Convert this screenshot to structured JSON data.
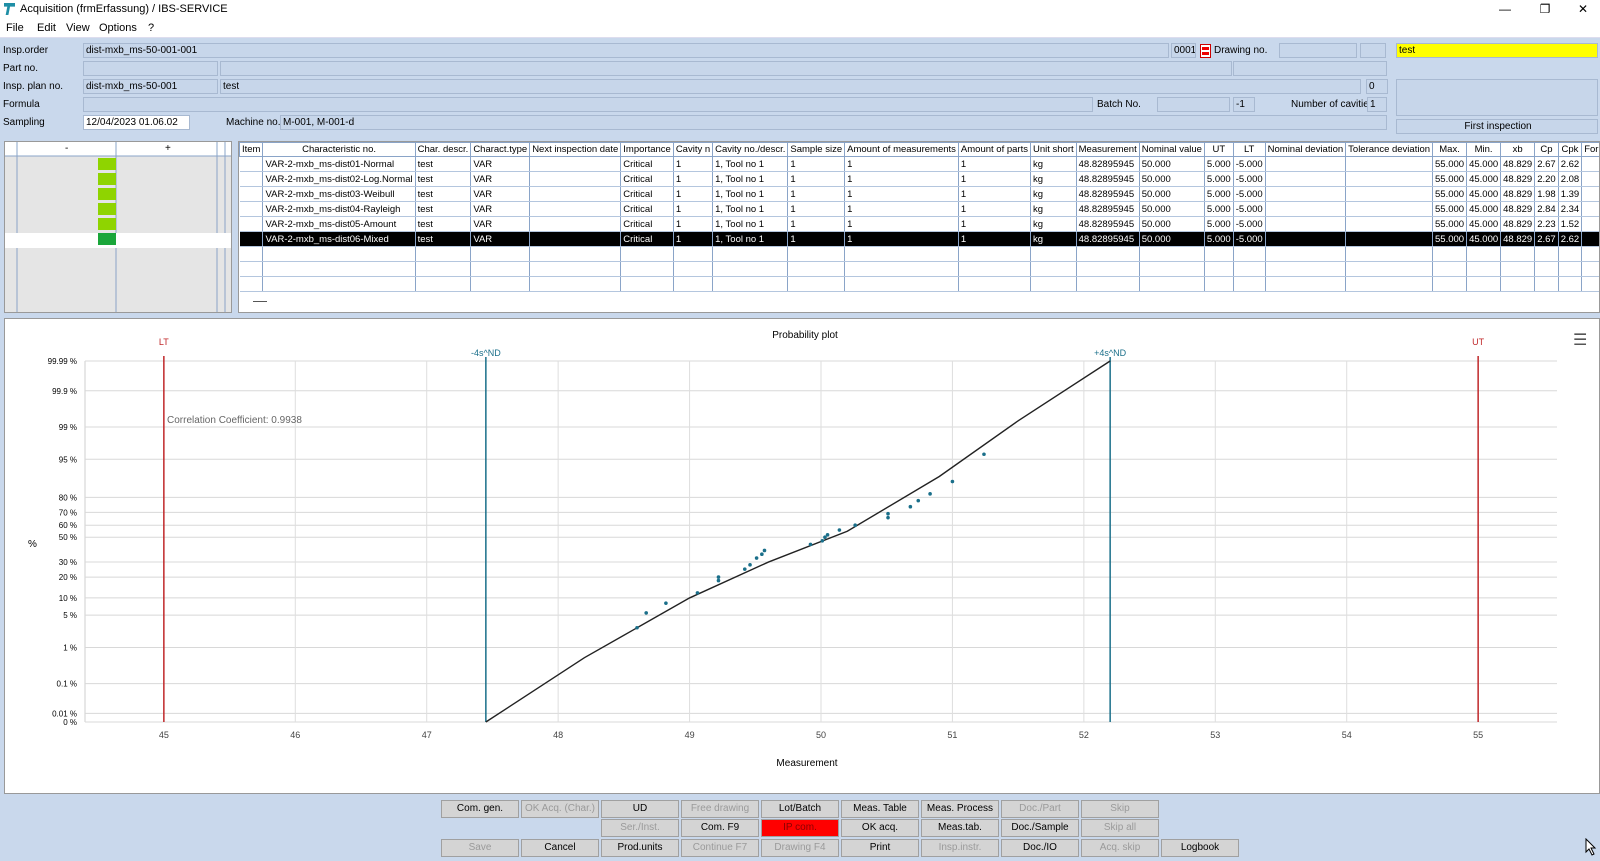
{
  "window": {
    "title": "Acquisition (frmErfassung) / IBS-SERVICE",
    "min": "—",
    "max": "❐",
    "close": "✕"
  },
  "menu": [
    "File",
    "Edit",
    "View",
    "Options",
    "?"
  ],
  "header": {
    "insp_order_label": "Insp.order",
    "insp_order_value": "dist-mxb_ms-50-001-001",
    "insp_order_num": "0001",
    "drawing_label": "Drawing no.",
    "yellow_value": "test",
    "part_label": "Part no.",
    "plan_label": "Insp. plan no.",
    "plan_value": "dist-mxb_ms-50-001",
    "plan_desc": "test",
    "plan_num": "0",
    "formula_label": "Formula",
    "batch_label": "Batch No.",
    "batch_num": "-1",
    "cavities_label": "Number of cavities",
    "cavities_value": "1",
    "sampling_label": "Sampling",
    "sampling_value": "12/04/2023 01.06.02",
    "machine_label": "Machine no.",
    "machine_value": "M-001, M-001-d",
    "first_inspection": "First inspection"
  },
  "left_panel": {
    "minus": "-",
    "plus": "+",
    "level_color": "#8fd400",
    "selected_level_color": "#1aa63a"
  },
  "table": {
    "columns": [
      "Item",
      "Characteristic no.",
      "Char. descr.",
      "Charact.type",
      "Next inspection date",
      "Importance",
      "Cavity n",
      "Cavity no./descr.",
      "Sample size",
      "Amount of measurements",
      "Amount of parts",
      "Unit short",
      "Measurement",
      "Nominal value",
      "UT",
      "LT",
      "Nominal deviation",
      "Tolerance deviation",
      "Max.",
      "Min.",
      "xb",
      "Cp",
      "Cpk",
      "Formula"
    ],
    "rows": [
      [
        "",
        "VAR-2-mxb_ms-dist01-Normal",
        "test",
        "VAR",
        "",
        "Critical",
        "1",
        "1, Tool no 1",
        "1",
        "1",
        "1",
        "kg",
        "48.82895945",
        "50.000",
        "5.000",
        "-5.000",
        "",
        "",
        "55.000",
        "45.000",
        "48.829",
        "2.67",
        "2.62",
        ""
      ],
      [
        "",
        "VAR-2-mxb_ms-dist02-Log.Normal",
        "test",
        "VAR",
        "",
        "Critical",
        "1",
        "1, Tool no 1",
        "1",
        "1",
        "1",
        "kg",
        "48.82895945",
        "50.000",
        "5.000",
        "-5.000",
        "",
        "",
        "55.000",
        "45.000",
        "48.829",
        "2.20",
        "2.08",
        ""
      ],
      [
        "",
        "VAR-2-mxb_ms-dist03-Weibull",
        "test",
        "VAR",
        "",
        "Critical",
        "1",
        "1, Tool no 1",
        "1",
        "1",
        "1",
        "kg",
        "48.82895945",
        "50.000",
        "5.000",
        "-5.000",
        "",
        "",
        "55.000",
        "45.000",
        "48.829",
        "1.98",
        "1.39",
        ""
      ],
      [
        "",
        "VAR-2-mxb_ms-dist04-Rayleigh",
        "test",
        "VAR",
        "",
        "Critical",
        "1",
        "1, Tool no 1",
        "1",
        "1",
        "1",
        "kg",
        "48.82895945",
        "50.000",
        "5.000",
        "-5.000",
        "",
        "",
        "55.000",
        "45.000",
        "48.829",
        "2.84",
        "2.34",
        ""
      ],
      [
        "",
        "VAR-2-mxb_ms-dist05-Amount",
        "test",
        "VAR",
        "",
        "Critical",
        "1",
        "1, Tool no 1",
        "1",
        "1",
        "1",
        "kg",
        "48.82895945",
        "50.000",
        "5.000",
        "-5.000",
        "",
        "",
        "55.000",
        "45.000",
        "48.829",
        "2.23",
        "1.52",
        ""
      ],
      [
        "",
        "VAR-2-mxb_ms-dist06-Mixed",
        "test",
        "VAR",
        "",
        "Critical",
        "1",
        "1, Tool no 1",
        "1",
        "1",
        "1",
        "kg",
        "48.82895945",
        "50.000",
        "5.000",
        "-5.000",
        "",
        "",
        "55.000",
        "45.000",
        "48.829",
        "2.67",
        "2.62",
        ""
      ]
    ],
    "selected_row": 5
  },
  "chart_data": {
    "type": "scatter",
    "title": "Probability plot",
    "xlabel": "Measurement",
    "ylabel": "%",
    "xlim": [
      44.4,
      55.6
    ],
    "x_ticks": [
      45,
      46,
      47,
      48,
      49,
      50,
      51,
      52,
      53,
      54,
      55
    ],
    "y_ticks": [
      "0 %",
      "0.01 %",
      "0.1 %",
      "1 %",
      "5 %",
      "10 %",
      "20 %",
      "30 %",
      "50 %",
      "60 %",
      "70 %",
      "80 %",
      "95 %",
      "99 %",
      "99.9 %",
      "99.99 %"
    ],
    "y_tick_values": [
      0,
      0.01,
      0.1,
      1,
      5,
      10,
      20,
      30,
      50,
      60,
      70,
      80,
      95,
      99,
      99.9,
      99.99
    ],
    "annotation": "Correlation Coefficient: 0.9938",
    "lines": [
      {
        "label": "LT",
        "x": 45,
        "color": "#c0282a"
      },
      {
        "label": "-4s^ND",
        "x": 47.45,
        "color": "#1a6f8a"
      },
      {
        "label": "+4s^ND",
        "x": 52.2,
        "color": "#1a6f8a"
      },
      {
        "label": "UT",
        "x": 55,
        "color": "#c0282a"
      }
    ],
    "fit_line": [
      [
        47.45,
        0
      ],
      [
        48.2,
        0.55
      ],
      [
        49.0,
        10
      ],
      [
        49.6,
        30
      ],
      [
        50.2,
        55
      ],
      [
        50.9,
        90
      ],
      [
        51.5,
        99.3
      ],
      [
        52.2,
        99.99
      ]
    ],
    "points": [
      [
        48.6,
        2.8
      ],
      [
        48.67,
        5.5
      ],
      [
        48.82,
        8.2
      ],
      [
        49.06,
        12
      ],
      [
        49.22,
        18
      ],
      [
        49.22,
        20
      ],
      [
        49.42,
        25
      ],
      [
        49.46,
        28
      ],
      [
        49.51,
        33
      ],
      [
        49.55,
        36
      ],
      [
        49.57,
        39
      ],
      [
        49.92,
        44
      ],
      [
        50.01,
        47
      ],
      [
        50.03,
        50
      ],
      [
        50.05,
        52
      ],
      [
        50.14,
        56
      ],
      [
        50.26,
        60
      ],
      [
        50.51,
        66
      ],
      [
        50.51,
        69
      ],
      [
        50.68,
        74
      ],
      [
        50.74,
        78
      ],
      [
        50.83,
        82
      ],
      [
        51.0,
        88
      ],
      [
        51.24,
        96
      ]
    ],
    "series_color": "#1a6f8a",
    "menu_icon": "☰"
  },
  "buttons": {
    "row1": [
      {
        "label": "Com. gen.",
        "enabled": true
      },
      {
        "label": "OK Acq. (Char.)",
        "enabled": false
      },
      {
        "label": "UD",
        "enabled": true
      },
      {
        "label": "Free drawing",
        "enabled": false
      },
      {
        "label": "Lot/Batch",
        "enabled": true
      },
      {
        "label": "Meas. Table",
        "enabled": true
      },
      {
        "label": "Meas. Process",
        "enabled": true
      },
      {
        "label": "Doc./Part",
        "enabled": false
      },
      {
        "label": "Skip",
        "enabled": false
      }
    ],
    "row2": [
      {
        "label": "Ser./Inst.",
        "enabled": false
      },
      {
        "label": "Com. F9",
        "enabled": true
      },
      {
        "label": "IP com.",
        "enabled": true,
        "red": true
      },
      {
        "label": "OK acq.",
        "enabled": true
      },
      {
        "label": "Meas.tab.",
        "enabled": true
      },
      {
        "label": "Doc./Sample",
        "enabled": true
      },
      {
        "label": "Skip all",
        "enabled": false
      }
    ],
    "row3": [
      {
        "label": "Save",
        "enabled": false
      },
      {
        "label": "Cancel",
        "enabled": true
      },
      {
        "label": "Prod.units",
        "enabled": true
      },
      {
        "label": "Continue F7",
        "enabled": false
      },
      {
        "label": "Drawing F4",
        "enabled": false
      },
      {
        "label": "Print",
        "enabled": true
      },
      {
        "label": "Insp.instr.",
        "enabled": false
      },
      {
        "label": "Doc./IO",
        "enabled": true
      },
      {
        "label": "Acq. skip",
        "enabled": false
      },
      {
        "label": "Logbook",
        "enabled": true
      }
    ]
  }
}
